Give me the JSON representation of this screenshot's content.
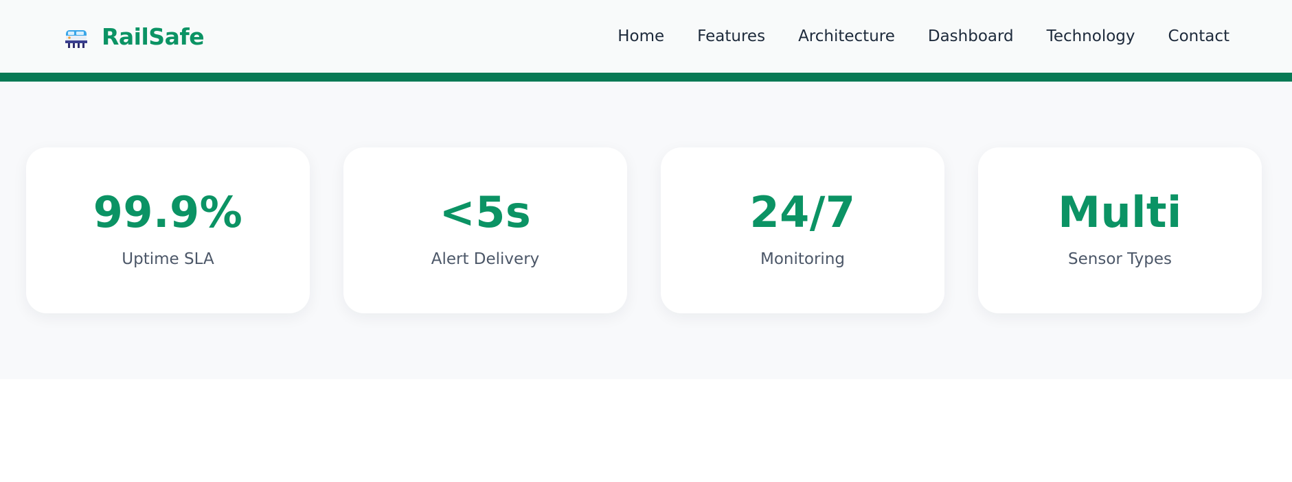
{
  "header": {
    "brand_name": "RailSafe",
    "brand_icon": "train-icon",
    "nav": [
      {
        "label": "Home"
      },
      {
        "label": "Features"
      },
      {
        "label": "Architecture"
      },
      {
        "label": "Dashboard"
      },
      {
        "label": "Technology"
      },
      {
        "label": "Contact"
      }
    ]
  },
  "stats": [
    {
      "value": "99.9%",
      "label": "Uptime SLA"
    },
    {
      "value": "<5s",
      "label": "Alert Delivery"
    },
    {
      "value": "24/7",
      "label": "Monitoring"
    },
    {
      "value": "Multi",
      "label": "Sensor Types"
    }
  ],
  "colors": {
    "accent": "#0b9364",
    "header_bar": "#087a55",
    "nav_text": "#1d2a3b",
    "label_text": "#4c5768",
    "section_bg": "#f8f9fb"
  }
}
